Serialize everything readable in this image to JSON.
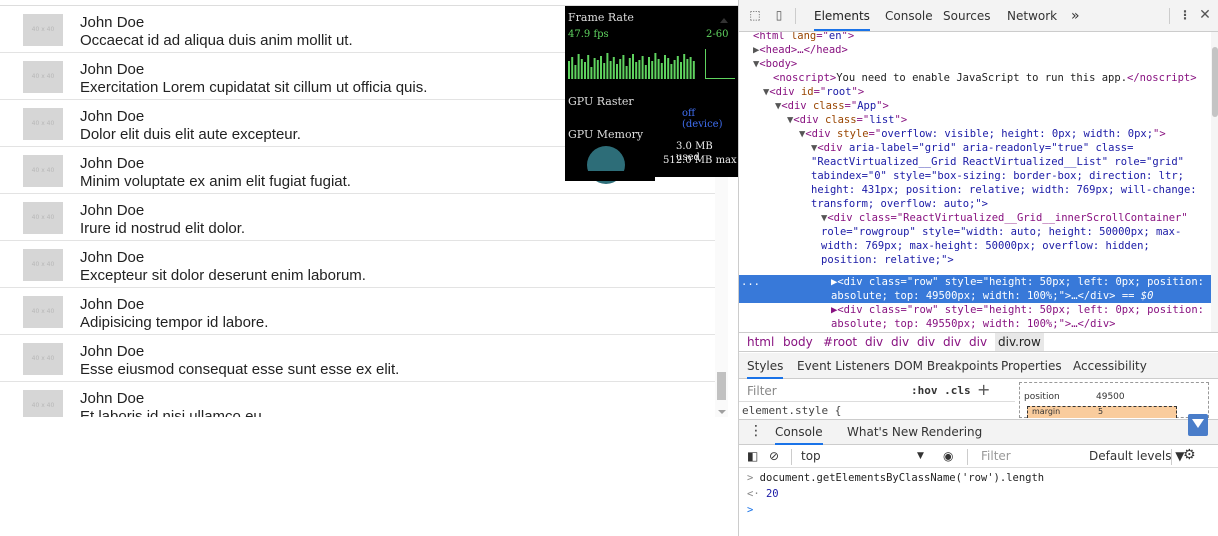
{
  "list": {
    "rows": [
      {
        "thumb": "40 x 40",
        "name": "John Doe",
        "text": "Occaecat id ad aliqua duis anim mollit ut."
      },
      {
        "thumb": "40 x 40",
        "name": "John Doe",
        "text": "Exercitation Lorem cupidatat sit cillum ut officia quis."
      },
      {
        "thumb": "40 x 40",
        "name": "John Doe",
        "text": "Dolor elit duis elit aute excepteur."
      },
      {
        "thumb": "40 x 40",
        "name": "John Doe",
        "text": "Minim voluptate ex anim elit fugiat fugiat."
      },
      {
        "thumb": "40 x 40",
        "name": "John Doe",
        "text": "Irure id nostrud elit dolor."
      },
      {
        "thumb": "40 x 40",
        "name": "John Doe",
        "text": "Excepteur sit dolor deserunt enim laborum."
      },
      {
        "thumb": "40 x 40",
        "name": "John Doe",
        "text": "Adipisicing tempor id labore."
      },
      {
        "thumb": "40 x 40",
        "name": "John Doe",
        "text": "Esse eiusmod consequat esse sunt esse ex elit."
      },
      {
        "thumb": "40 x 40",
        "name": "John Doe",
        "text": "Et laboris id nisi ullamco eu."
      }
    ]
  },
  "fps_meter": {
    "frame_rate_label": "Frame Rate",
    "fps_value": "47.9 fps",
    "fps_range": "2-60",
    "gpu_raster_label": "GPU Raster",
    "gpu_raster_value": "off (device)",
    "gpu_memory_label": "GPU Memory",
    "mem_used": "3.0 MB used",
    "mem_max": "512.0 MB max",
    "colors": {
      "green": "#5fd35f",
      "blue": "#3f6ef0",
      "gauge": "#2d6d78"
    }
  },
  "devtools": {
    "tabs": [
      "Elements",
      "Console",
      "Sources",
      "Network"
    ],
    "more_tabs": "»",
    "active_tab": "Elements",
    "dom": {
      "html_lang": "en",
      "noscript_text": "You need to enable JavaScript to run this app.",
      "root_id": "root",
      "app_class": "App",
      "list_class": "list",
      "outer_style": "overflow: visible; height: 0px; width: 0px;",
      "grid_line1": "aria-label=\"grid\" aria-readonly=\"true\" class=",
      "grid_line2": "\"ReactVirtualized__Grid ReactVirtualized__List\" role=\"grid\"",
      "grid_line3": "tabindex=\"0\" style=\"box-sizing: border-box; direction: ltr;",
      "grid_line4": "height: 431px; position: relative; width: 769px; will-change:",
      "grid_line5": "transform; overflow: auto;\">",
      "inner_line1": "<div class=\"ReactVirtualized__Grid__innerScrollContainer\"",
      "inner_line2": "role=\"rowgroup\" style=\"width: auto; height: 50000px; max-",
      "inner_line3": "width: 769px; max-height: 50000px; overflow: hidden;",
      "inner_line4": "position: relative;\">",
      "sel_line1": "▶<div class=\"row\" style=\"height: 50px; left: 0px; position:",
      "sel_line2": "absolute; top: 49500px; width: 100%;\">…</div>",
      "sel_marker": "== $0",
      "next_line1": "▶<div class=\"row\" style=\"height: 50px; left: 0px; position:",
      "next_line2": "absolute; top: 49550px; width: 100%;\">…</div>",
      "ellipsis": "..."
    },
    "breadcrumbs": [
      "html",
      "body",
      "#root",
      "div",
      "div",
      "div",
      "div",
      "div",
      "div.row"
    ],
    "styles_tabs": [
      "Styles",
      "Event Listeners",
      "DOM Breakpoints",
      "Properties",
      "Accessibility"
    ],
    "filter_placeholder": "Filter",
    "hov_cls": ":hov  .cls",
    "element_style": "element.style {",
    "box_model": {
      "position_label": "position",
      "position_value": "49500",
      "margin_label": "margin",
      "margin_value": "5"
    },
    "drawer_tabs": [
      "Console",
      "What's New",
      "Rendering"
    ],
    "console": {
      "context": "top",
      "filter_placeholder": "Filter",
      "levels": "Default levels ▼",
      "input_line": "document.getElementsByClassName('row').length",
      "result": "20"
    }
  }
}
